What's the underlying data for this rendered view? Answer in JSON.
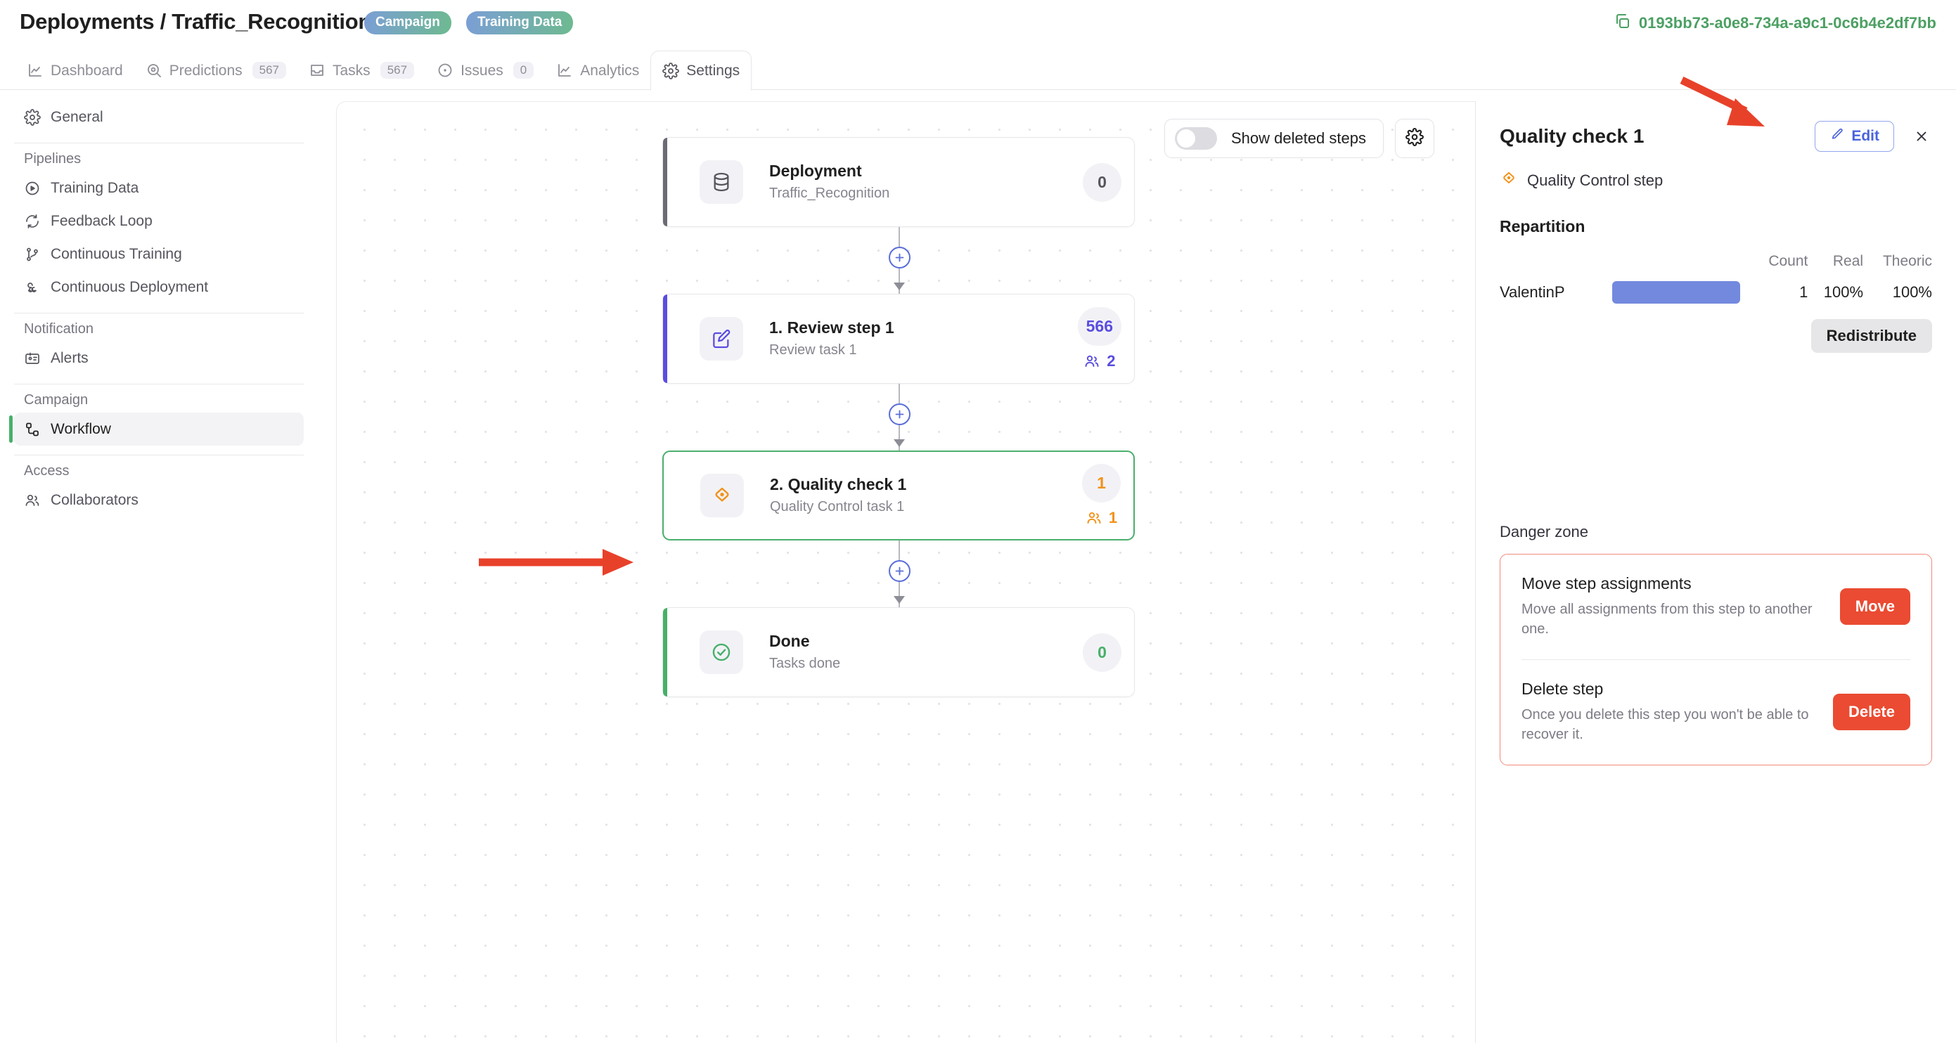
{
  "header": {
    "breadcrumb": "Deployments / Traffic_Recognition",
    "badges": [
      {
        "label": "Campaign"
      },
      {
        "label": "Training Data"
      }
    ],
    "deployment_id": "0193bb73-a0e8-734a-a9c1-0c6b4e2df7bb",
    "copy_icon": "copy-icon"
  },
  "tabs": [
    {
      "label": "Dashboard",
      "icon": "chart-line-icon",
      "badge": null,
      "active": false
    },
    {
      "label": "Predictions",
      "icon": "target-search-icon",
      "badge": "567",
      "active": false
    },
    {
      "label": "Tasks",
      "icon": "inbox-icon",
      "badge": "567",
      "active": false
    },
    {
      "label": "Issues",
      "icon": "dot-circle-icon",
      "badge": "0",
      "active": false
    },
    {
      "label": "Analytics",
      "icon": "chart-line-icon",
      "badge": null,
      "active": false
    },
    {
      "label": "Settings",
      "icon": "gear-icon",
      "badge": null,
      "active": true
    }
  ],
  "sidebar": {
    "general": {
      "label": "General",
      "icon": "gear-icon"
    },
    "groups": [
      {
        "title": "Pipelines",
        "items": [
          {
            "label": "Training Data",
            "icon": "play-circle-icon"
          },
          {
            "label": "Feedback Loop",
            "icon": "refresh-icon"
          },
          {
            "label": "Continuous Training",
            "icon": "git-branch-icon"
          },
          {
            "label": "Continuous Deployment",
            "icon": "webhook-icon"
          }
        ]
      },
      {
        "title": "Notification",
        "items": [
          {
            "label": "Alerts",
            "icon": "id-card-icon"
          }
        ]
      },
      {
        "title": "Campaign",
        "items": [
          {
            "label": "Workflow",
            "icon": "workflow-icon",
            "active": true
          }
        ]
      },
      {
        "title": "Access",
        "items": [
          {
            "label": "Collaborators",
            "icon": "users-icon"
          }
        ]
      }
    ]
  },
  "canvas": {
    "toolbar": {
      "toggle_label": "Show deleted steps",
      "toggle_on": false,
      "settings_icon": "gear-icon"
    },
    "steps": [
      {
        "title": "Deployment",
        "subtitle": "Traffic_Recognition",
        "count": "0",
        "assignees": null,
        "icon": "database-icon",
        "accent_color": "#6b6b75",
        "icon_color": "#55555d",
        "count_color": "#55555d",
        "selected": false
      },
      {
        "title": "1. Review step 1",
        "subtitle": "Review task 1",
        "count": "566",
        "assignees": "2",
        "icon": "pencil-square-icon",
        "accent_color": "#5a4de0",
        "icon_color": "#5a4de0",
        "count_color": "#5a4de0",
        "selected": false
      },
      {
        "title": "2. Quality check 1",
        "subtitle": "Quality Control task 1",
        "count": "1",
        "assignees": "1",
        "icon": "eye-diamond-icon",
        "accent_color": "#f29219",
        "icon_color": "#f29219",
        "count_color": "#f29219",
        "selected": true
      },
      {
        "title": "Done",
        "subtitle": "Tasks done",
        "count": "0",
        "assignees": null,
        "icon": "check-circle-icon",
        "accent_color": "#47b06a",
        "icon_color": "#47b06a",
        "count_color": "#47b06a",
        "selected": false
      }
    ],
    "add_step_icon": "plus-circle-icon"
  },
  "panel": {
    "title": "Quality check 1",
    "edit_label": "Edit",
    "edit_icon": "pencil-icon",
    "close_icon": "close-icon",
    "step_type": "Quality Control step",
    "step_type_icon": "eye-diamond-icon",
    "repartition_title": "Repartition",
    "columns": {
      "name": "",
      "bar": "",
      "count": "Count",
      "real": "Real",
      "theoric": "Theoric"
    },
    "rows": [
      {
        "name": "ValentinP",
        "bar_pct": 100,
        "count": "1",
        "real": "100%",
        "theoric": "100%"
      }
    ],
    "redistribute_label": "Redistribute",
    "danger": {
      "label": "Danger zone",
      "items": [
        {
          "title": "Move step assignments",
          "desc": "Move all assignments from this step to another one.",
          "button": "Move"
        },
        {
          "title": "Delete step",
          "desc": "Once you delete this step you won't be able to recover it.",
          "button": "Delete"
        }
      ]
    }
  },
  "annotations": {
    "arrow_color": "#e8412a"
  },
  "colors": {
    "accent_blue": "#4a63dd",
    "green": "#4ca063",
    "orange": "#f29219",
    "danger_red": "#ea4b32",
    "bar_blue": "#7289de"
  }
}
